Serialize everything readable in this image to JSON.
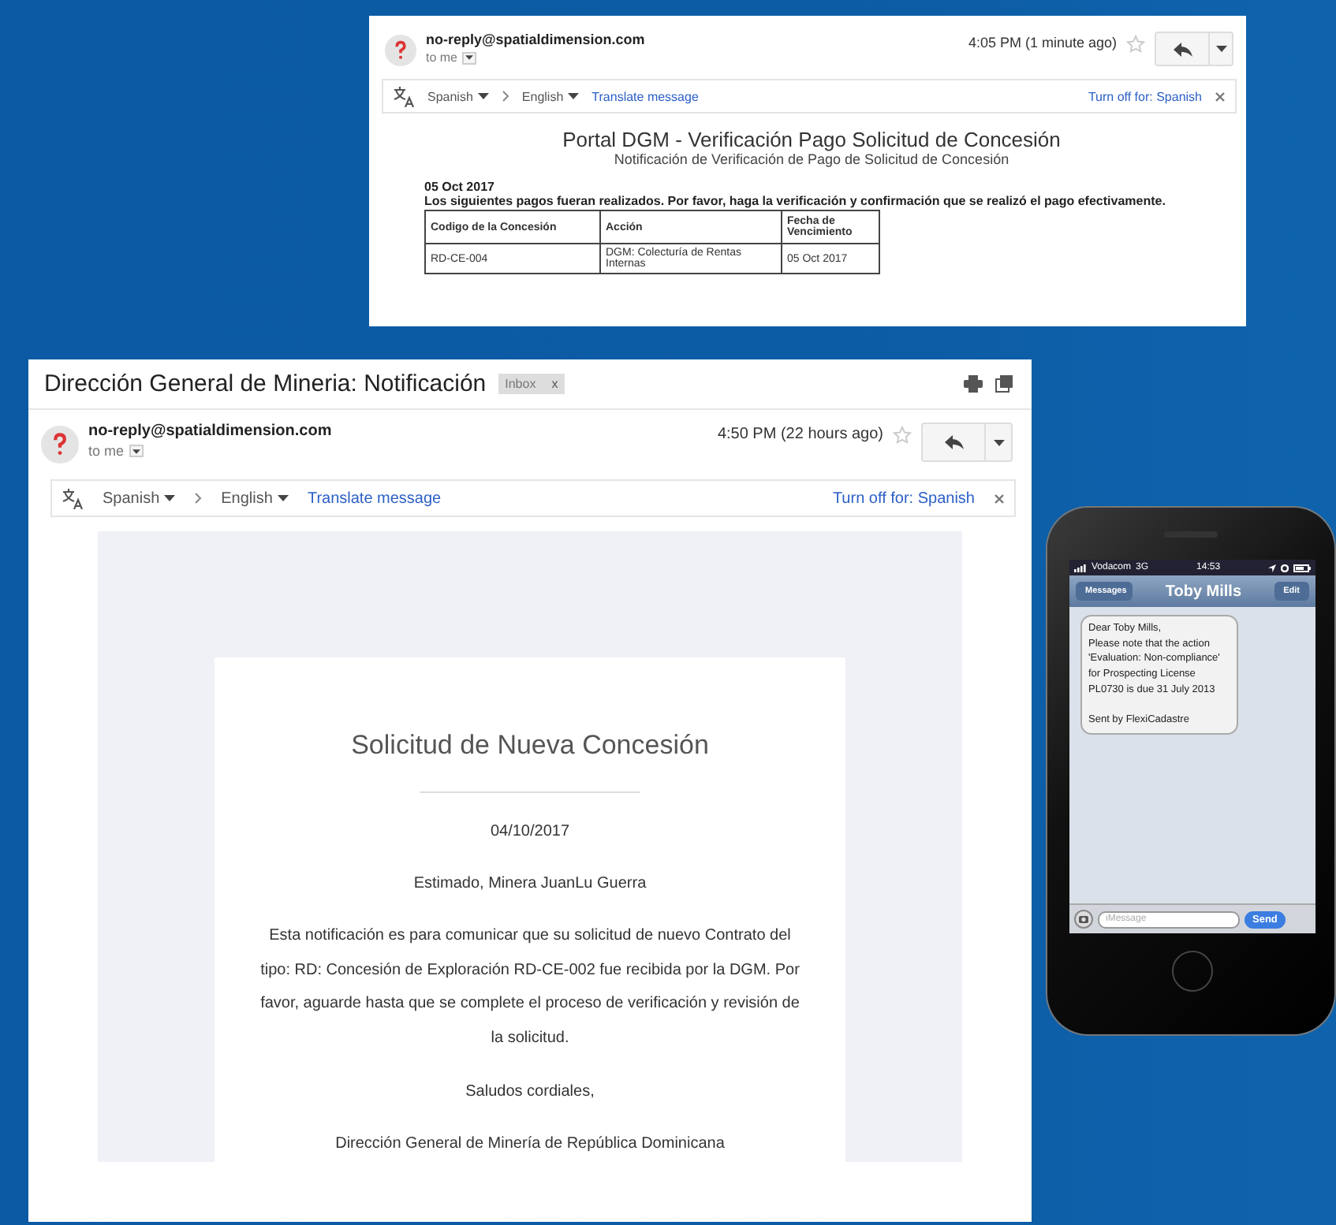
{
  "payment_email": {
    "sender": "no-reply@spatialdimension.com",
    "recipient": "to me",
    "time": "4:05 PM (1 minute ago)",
    "starred": false,
    "translate": {
      "from": "Spanish",
      "to": "English",
      "action": "Translate message",
      "turn_off": "Turn off for: Spanish"
    },
    "title": "Portal DGM - Verificación Pago Solicitud de Concesión",
    "subtitle": "Notificación de Verificación de Pago de Solicitud de Concesión",
    "date": "05 Oct 2017",
    "message": "Los siguientes pagos fueran realizados. Por favor, haga la verificación y confirmación que se realizó el pago efectivamente.",
    "table": {
      "columns": [
        "Codigo de la Concesión",
        "Acción",
        "Fecha de Vencimiento"
      ],
      "rows": [
        [
          "RD-CE-004",
          "DGM: Colecturía de Rentas Internas",
          "05 Oct 2017"
        ]
      ]
    }
  },
  "notification_email": {
    "subject": "Dirección General de Mineria: Notificación",
    "label": "Inbox",
    "label_close": "x",
    "sender": "no-reply@spatialdimension.com",
    "recipient": "to me",
    "time": "4:50 PM (22 hours ago)",
    "starred": false,
    "translate": {
      "from": "Spanish",
      "to": "English",
      "action": "Translate message",
      "turn_off": "Turn off for: Spanish"
    },
    "heading": "Solicitud de Nueva Concesión",
    "date": "04/10/2017",
    "greeting": "Estimado, Minera JuanLu Guerra",
    "paragraph": "Esta notificación es para comunicar que su solicitud de nuevo Contrato del tipo: RD: Concesión de Exploración RD-CE-002 fue recibida por la DGM. Por favor, aguarde hasta que se complete el proceso de verificación y revisión de la solicitud.",
    "closing": "Saludos cordiales,",
    "signature": "Dirección General de Minería de República Dominicana"
  },
  "phone": {
    "carrier": "Vodacom",
    "network": "3G",
    "clock": "14:53",
    "back": "Messages",
    "contact": "Toby Mills",
    "edit": "Edit",
    "messages": [
      {
        "text": "Dear Toby Mills,\nPlease note that the action 'Evaluation: Non-compliance' for Prospecting License PL0730 is due 31 July 2013\n\nSent by FlexiCadastre"
      }
    ],
    "placeholder": "iMessage",
    "send": "Send"
  }
}
